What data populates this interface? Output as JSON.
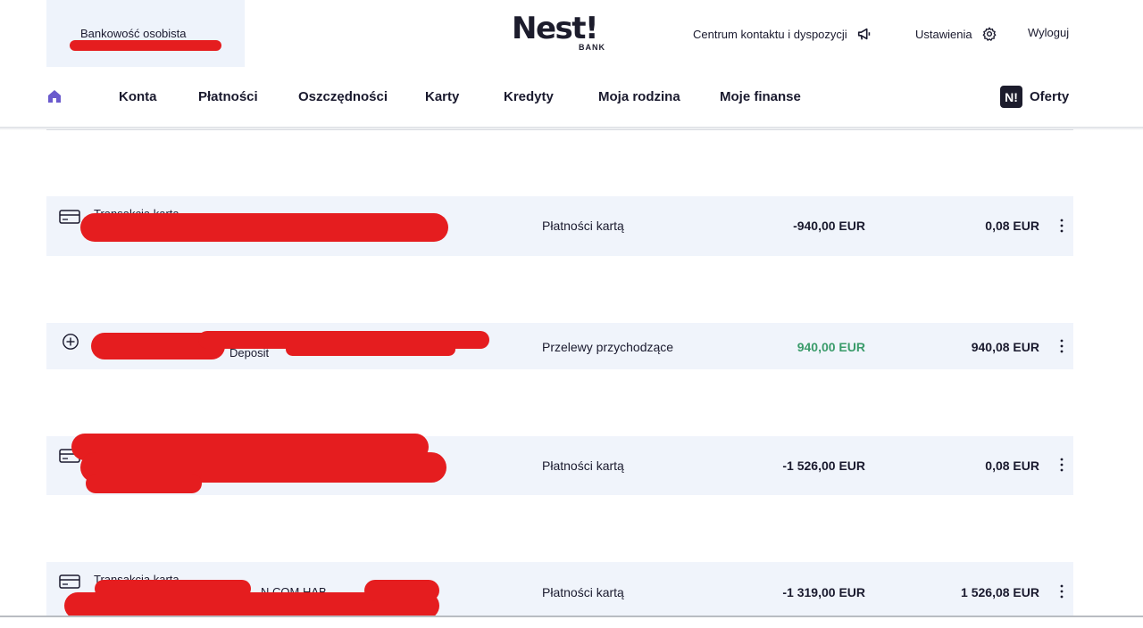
{
  "header": {
    "profile_label": "Bankowość osobista",
    "logo_text": "Nest!",
    "logo_sub": "BANK",
    "contact_link": "Centrum kontaktu i dyspozycji",
    "settings_link": "Ustawienia",
    "logout_link": "Wyloguj"
  },
  "nav": {
    "items": [
      "Konta",
      "Płatności",
      "Oszczędności",
      "Karty",
      "Kredyty",
      "Moja rodzina",
      "Moje finanse"
    ],
    "offers_badge": "N!",
    "offers_label": "Oferty"
  },
  "transactions": [
    {
      "icon": "card-icon",
      "title": "Transakcja kartą",
      "sub": "Nr",
      "category": "Płatności kartą",
      "amount": "-940,00 EUR",
      "balance": "0,08 EUR"
    },
    {
      "icon": "plus-circle-icon",
      "title": "",
      "sub": "Deposit",
      "category": "Przelewy przychodzące",
      "amount": "940,00 EUR",
      "balance": "940,08 EUR"
    },
    {
      "icon": "card-icon",
      "title": "",
      "sub": "",
      "category": "Płatności kartą",
      "amount": "-1 526,00 EUR",
      "balance": "0,08 EUR"
    },
    {
      "icon": "card-icon",
      "title": "Transakcja kartą",
      "sub": "N.COM HAB",
      "category": "Płatności kartą",
      "amount": "-1 319,00 EUR",
      "balance": "1 526,08 EUR"
    }
  ],
  "colors": {
    "accent": "#6a5acd",
    "positive": "#3a9b6a",
    "row_bg": "#f0f4fb",
    "redaction": "#e51d1f"
  }
}
